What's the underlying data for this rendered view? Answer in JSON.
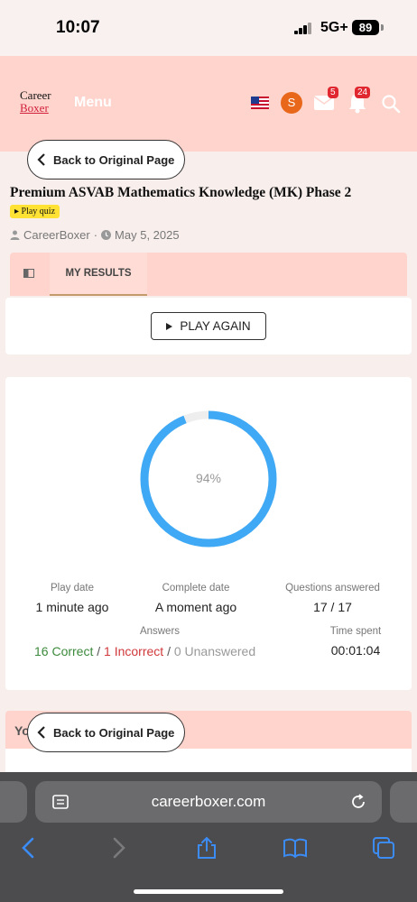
{
  "status_bar": {
    "time": "10:07",
    "network": "5G+",
    "battery": "89"
  },
  "header": {
    "logo_line1": "Career",
    "logo_line2": "Boxer",
    "menu_label": "Menu",
    "avatar_letter": "S",
    "mail_badge": "5",
    "notification_badge": "24"
  },
  "back_button_label": "Back to Original Page",
  "quiz": {
    "title": "Premium ASVAB Mathematics Knowledge (MK) Phase 2",
    "play_tag": "Play quiz",
    "author": "CareerBoxer",
    "separator": "·",
    "date": "May 5, 2025"
  },
  "tabs": {
    "results_label": "MY RESULTS"
  },
  "play_again_label": "PLAY AGAIN",
  "results": {
    "score_percent": 94,
    "score_label": "94%",
    "ring_color": "#3fa9f5",
    "play_date_label": "Play date",
    "play_date_value": "1 minute ago",
    "complete_date_label": "Complete date",
    "complete_date_value": "A moment ago",
    "questions_label": "Questions answered",
    "questions_value": "17 / 17",
    "answers_label": "Answers",
    "correct": "16 Correct",
    "incorrect": "1 Incorrect",
    "unanswered": "0 Unanswered",
    "slash": "/",
    "time_spent_label": "Time spent",
    "time_spent_value": "00:01:04"
  },
  "bottom_section": {
    "heading_partial": "Yo"
  },
  "browser": {
    "url": "careerboxer.com"
  },
  "colors": {
    "header_bg": "#ffd4cd",
    "brand_red": "#d11f3a",
    "avatar": "#e8671a",
    "accent_blue": "#3fa9f5"
  }
}
